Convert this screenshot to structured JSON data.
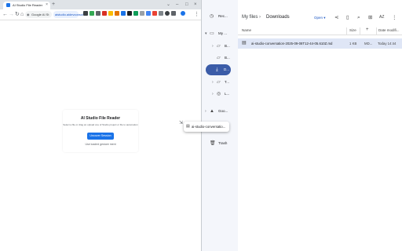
{
  "browser": {
    "tab_title": "AI Studio File Reader",
    "tab_close": "×",
    "new_tab": "+",
    "window_controls": [
      "⌄",
      "–",
      "□",
      "×"
    ],
    "nav": {
      "back": "←",
      "forward": "→",
      "reload": "↻",
      "home": "⌂"
    },
    "omnibox_text": "Google AI St",
    "secondary_omnibox_text": "aistudio.aidevconsol",
    "menu": "⋮"
  },
  "page": {
    "title": "AI Studio File Reader",
    "description": "Select a file or drag an upload one of Studio project or file to automation",
    "button_label": "Uncover Session",
    "open_text": "Use loaded gesture ment"
  },
  "files": {
    "nav": {
      "recent": "Rec...",
      "my_files": "My ...",
      "folder1": "B...",
      "folder2": "B...",
      "downloads": "D...",
      "folder3": "T...",
      "folder4": "L...",
      "google_drive": "Goo...",
      "trash": "Trash"
    },
    "breadcrumb": [
      "My files",
      "Downloads"
    ],
    "breadcrumb_separator": "›",
    "open_button": "Open",
    "open_chevron": "▾",
    "columns": {
      "name": "Name",
      "size": "Size",
      "type": "Type",
      "date": "Date modifi..."
    },
    "sort_button": "AZ",
    "file": {
      "name": "ai-studio-conversation-2025-09-08T12-44-05.610Z.md",
      "size": "1 KB",
      "type": "MD...",
      "date": "Today 14:44"
    },
    "drag_label": "ai-studio-conversatio..."
  },
  "colors": {
    "accent": "#1a73e8",
    "files_selected_nav": "#3b5ca8",
    "files_selected_row": "#dfe6f6"
  }
}
